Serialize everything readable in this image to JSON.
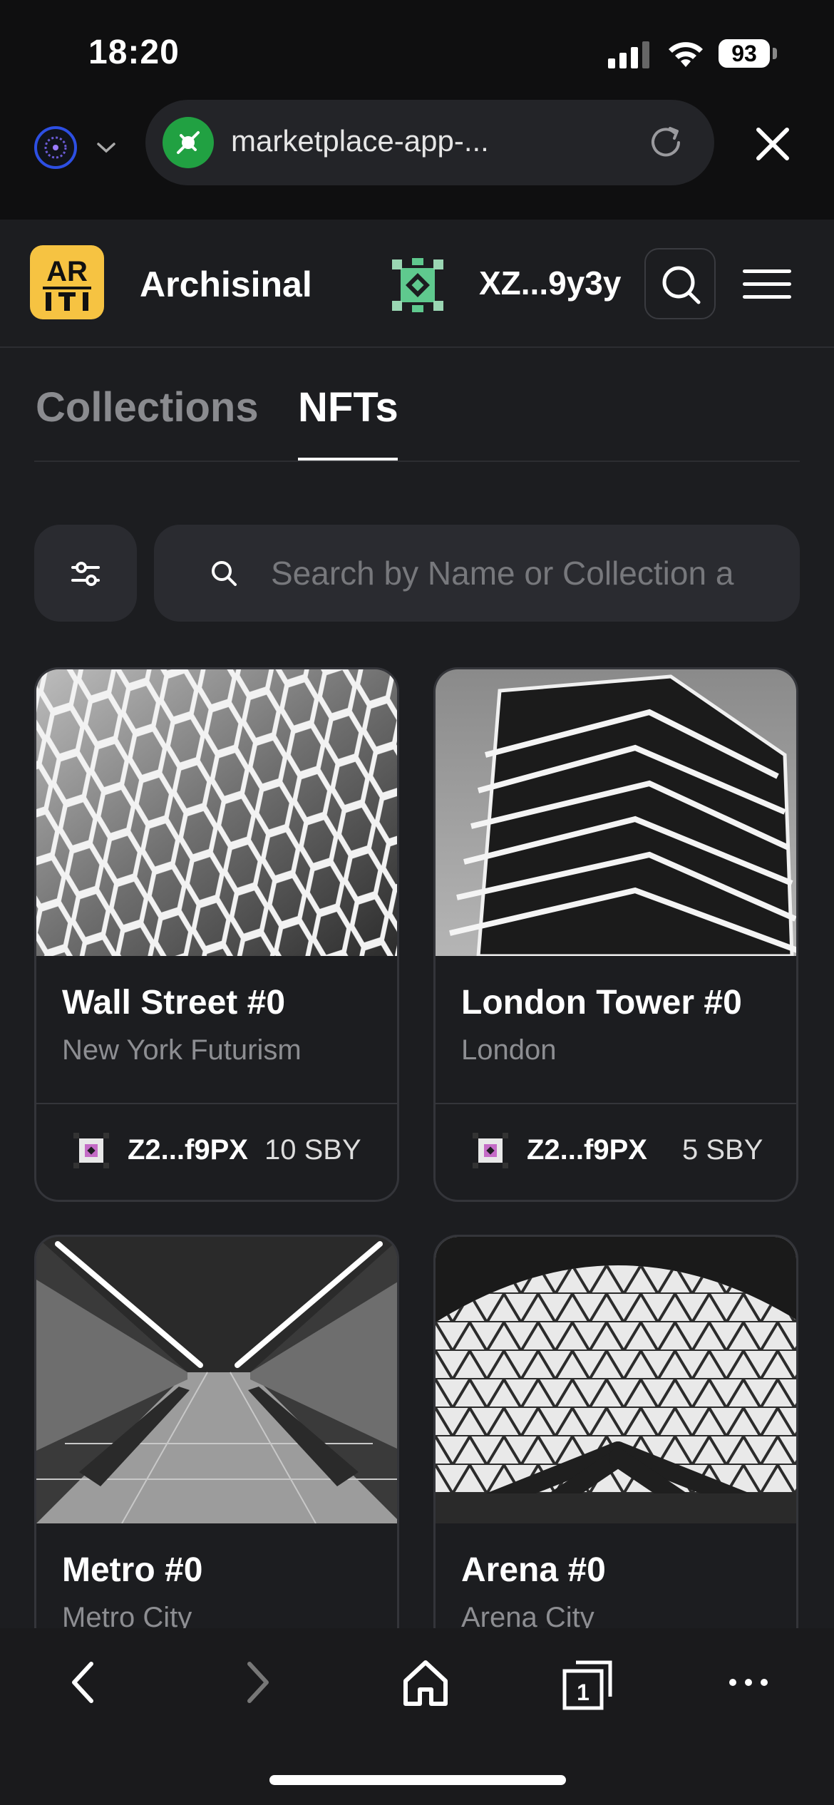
{
  "status_bar": {
    "time": "18:20",
    "battery": "93"
  },
  "browser": {
    "url": "marketplace-app-...",
    "network_icon": "astar-network-icon",
    "secure_icon": "shield-check-icon"
  },
  "header": {
    "brand": "Archisinal",
    "logo_text": "AR",
    "account_address": "XZ...9y3y",
    "accent_color": "#f6c342"
  },
  "tabs": [
    {
      "label": "Collections",
      "active": false
    },
    {
      "label": "NFTs",
      "active": true
    }
  ],
  "search": {
    "placeholder": "Search by Name or Collection a"
  },
  "nfts": [
    {
      "title": "Wall Street #0",
      "collection": "New York Futurism",
      "owner": "Z2...f9PX",
      "price": "10 SBY"
    },
    {
      "title": "London Tower #0",
      "collection": "London",
      "owner": "Z2...f9PX",
      "price": "5 SBY"
    },
    {
      "title": "Metro #0",
      "collection": "Metro City"
    },
    {
      "title": "Arena #0",
      "collection": "Arena City"
    }
  ],
  "bottom_nav": {
    "tab_count": "1"
  }
}
